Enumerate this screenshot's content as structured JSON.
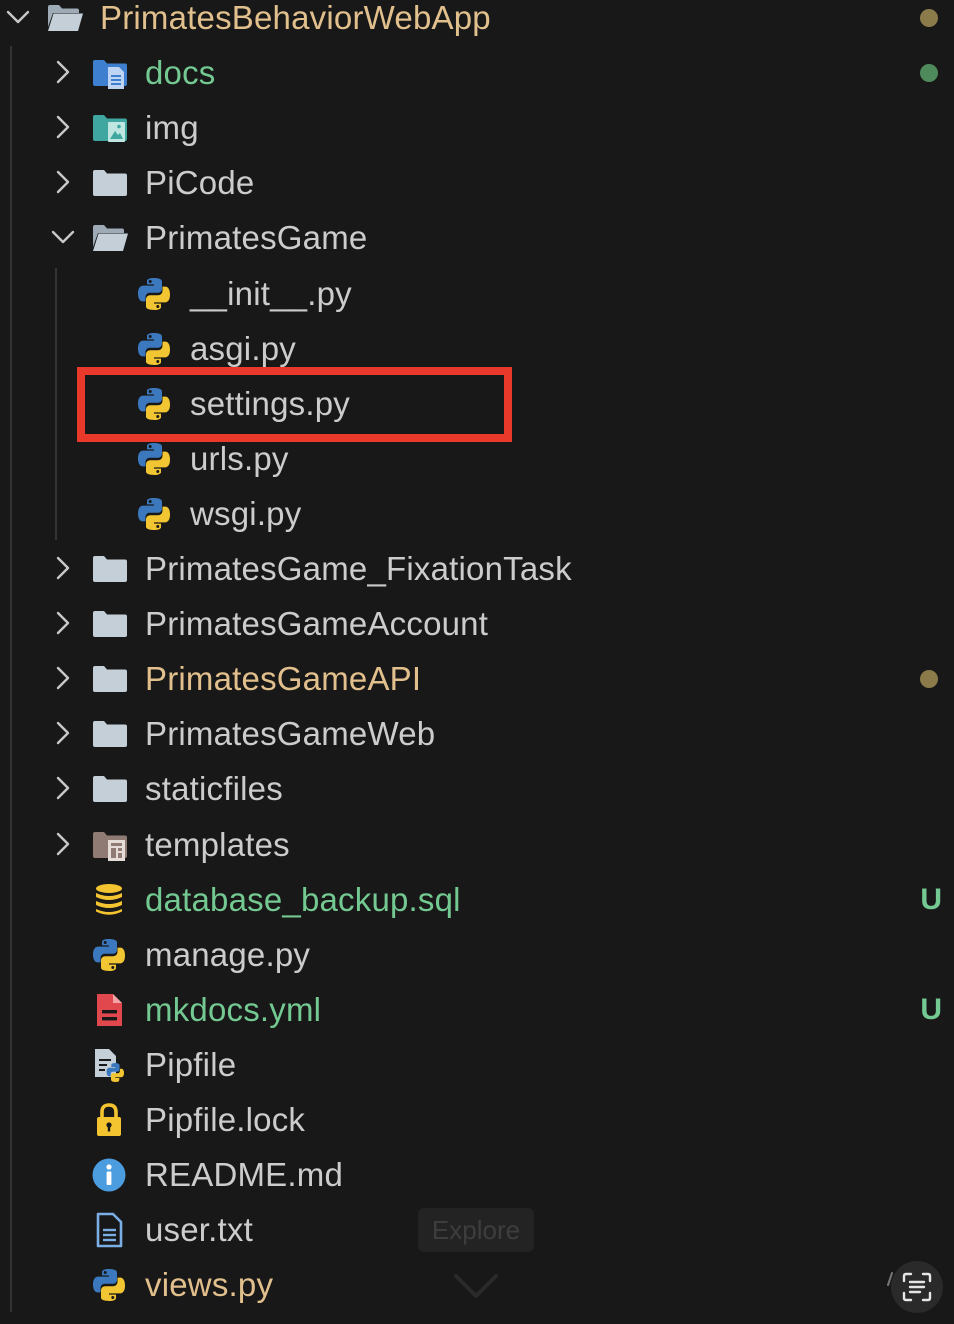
{
  "colors": {
    "background": "#181818",
    "default_text": "#cccccc",
    "modified_text": "#e2c08d",
    "untracked_text": "#73c991",
    "modified_dot": "#8b7a4a",
    "untracked_dot": "#4e8a5b",
    "highlight_box": "#e8392b"
  },
  "explorer": {
    "root": {
      "label": "PrimatesBehaviorWebApp",
      "expanded": true,
      "status": "modified"
    },
    "items": [
      {
        "label": "docs",
        "kind": "folder",
        "icon": "docs-folder-icon",
        "expanded": false,
        "status": "untracked-dot"
      },
      {
        "label": "img",
        "kind": "folder",
        "icon": "images-folder-icon",
        "expanded": false,
        "status": ""
      },
      {
        "label": "PiCode",
        "kind": "folder",
        "icon": "folder-icon",
        "expanded": false,
        "status": ""
      },
      {
        "label": "PrimatesGame",
        "kind": "folder",
        "icon": "folder-open-icon",
        "expanded": true,
        "status": ""
      },
      {
        "label": "__init__.py",
        "kind": "file",
        "icon": "python-icon",
        "status": ""
      },
      {
        "label": "asgi.py",
        "kind": "file",
        "icon": "python-icon",
        "status": ""
      },
      {
        "label": "settings.py",
        "kind": "file",
        "icon": "python-icon",
        "status": "",
        "highlighted": true
      },
      {
        "label": "urls.py",
        "kind": "file",
        "icon": "python-icon",
        "status": ""
      },
      {
        "label": "wsgi.py",
        "kind": "file",
        "icon": "python-icon",
        "status": ""
      },
      {
        "label": "PrimatesGame_FixationTask",
        "kind": "folder",
        "icon": "folder-icon",
        "expanded": false,
        "status": ""
      },
      {
        "label": "PrimatesGameAccount",
        "kind": "folder",
        "icon": "folder-icon",
        "expanded": false,
        "status": ""
      },
      {
        "label": "PrimatesGameAPI",
        "kind": "folder",
        "icon": "folder-icon",
        "expanded": false,
        "status": "modified"
      },
      {
        "label": "PrimatesGameWeb",
        "kind": "folder",
        "icon": "folder-icon",
        "expanded": false,
        "status": ""
      },
      {
        "label": "staticfiles",
        "kind": "folder",
        "icon": "folder-icon",
        "expanded": false,
        "status": ""
      },
      {
        "label": "templates",
        "kind": "folder",
        "icon": "templates-folder-icon",
        "expanded": false,
        "status": ""
      },
      {
        "label": "database_backup.sql",
        "kind": "file",
        "icon": "database-icon",
        "status": "untracked",
        "badge": "U"
      },
      {
        "label": "manage.py",
        "kind": "file",
        "icon": "python-icon",
        "status": ""
      },
      {
        "label": "mkdocs.yml",
        "kind": "file",
        "icon": "yaml-file-icon",
        "status": "untracked",
        "badge": "U"
      },
      {
        "label": "Pipfile",
        "kind": "file",
        "icon": "pipfile-icon",
        "status": ""
      },
      {
        "label": "Pipfile.lock",
        "kind": "file",
        "icon": "lock-icon",
        "status": ""
      },
      {
        "label": "README.md",
        "kind": "file",
        "icon": "info-icon",
        "status": ""
      },
      {
        "label": "user.txt",
        "kind": "file",
        "icon": "text-file-icon",
        "status": ""
      },
      {
        "label": "views.py",
        "kind": "file",
        "icon": "python-icon",
        "status": "modified"
      }
    ]
  },
  "overlay": {
    "tooltip_label": "Explore"
  }
}
